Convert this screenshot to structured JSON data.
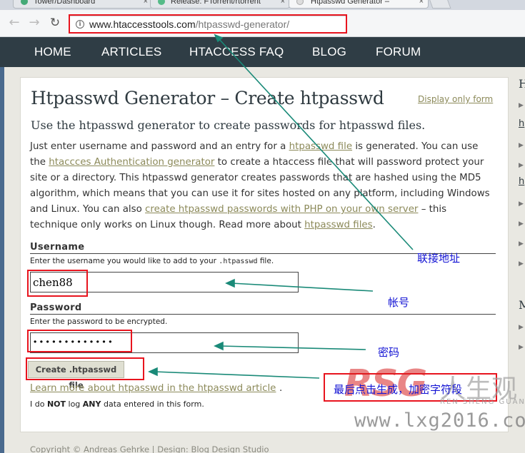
{
  "browser": {
    "tabs": [
      {
        "label": "Tower/Dashboard",
        "fav": "#4a7"
      },
      {
        "label": "Release: FTorrent/rtorrent",
        "fav": "#5b8"
      },
      {
        "label": "Htpasswd Generator –",
        "fav": "#e9e9e9"
      }
    ],
    "tab_close": "×",
    "url_host": "www.htaccesstools.com",
    "url_path": "/htpasswd-generator/"
  },
  "site_nav": [
    "HOME",
    "ARTICLES",
    "HTACCESS FAQ",
    "BLOG",
    "FORUM"
  ],
  "page": {
    "title": "Htpasswd Generator – Create htpasswd",
    "display_only_form": "Display only form",
    "subtitle": "Use the htpasswd generator to create passwords for htpasswd files.",
    "intro": {
      "t1": "Just enter username and password and an entry for a ",
      "l1": "htpasswd file",
      "t2": " is generated. You can use the ",
      "l2": "htaccces Authentication generator",
      "t3": " to create a htaccess file that will password protect your site or a directory. This htpasswd generator creates passwords that are hashed using the MD5 algorithm, which means that you can use it for sites hosted on any platform, including Windows and Linux. You can also ",
      "l3": "create htpasswd passwords with PHP on your own server",
      "t4": " – this technique only works on Linux though. Read more about ",
      "l4": "htpasswd files",
      "t5": "."
    },
    "username_label": "Username",
    "username_desc_pre": "Enter the username you would like to add to your ",
    "username_desc_code": ".htpasswd",
    "username_desc_post": " file.",
    "username_value": "chen88",
    "password_label": "Password",
    "password_desc": "Enter the password to be encrypted.",
    "password_value": "·············",
    "create_button": "Create .htpasswd file",
    "learn_more": "Learn more about htpasswd in the htpasswd article",
    "learn_more_end": ".",
    "nolog_1": "I do ",
    "nolog_not": "NOT",
    "nolog_2": " log ",
    "nolog_any": "ANY",
    "nolog_3": " data entered in this form."
  },
  "sidebar": {
    "heading_1": "H",
    "heading_2": "M",
    "link_1": "h",
    "link_2": "h"
  },
  "copyright": "Copyright © Andreas Gehrke | Design: Blog Design Studio",
  "annotations": {
    "url": "联接地址",
    "username": "帐号",
    "password": "密码",
    "button": "最后点击生成，加密字符段"
  },
  "watermark": {
    "logo": "RSG",
    "cn": "人生观",
    "pinyin": "REN SHENG GUAN",
    "url": "www.lxg2016.com"
  },
  "colors": {
    "nav_bg": "#2f3d45",
    "link": "#8c8a5a",
    "annotation": "#1414d4",
    "highlight": "#e8141e",
    "arrow": "#1a8a78"
  }
}
